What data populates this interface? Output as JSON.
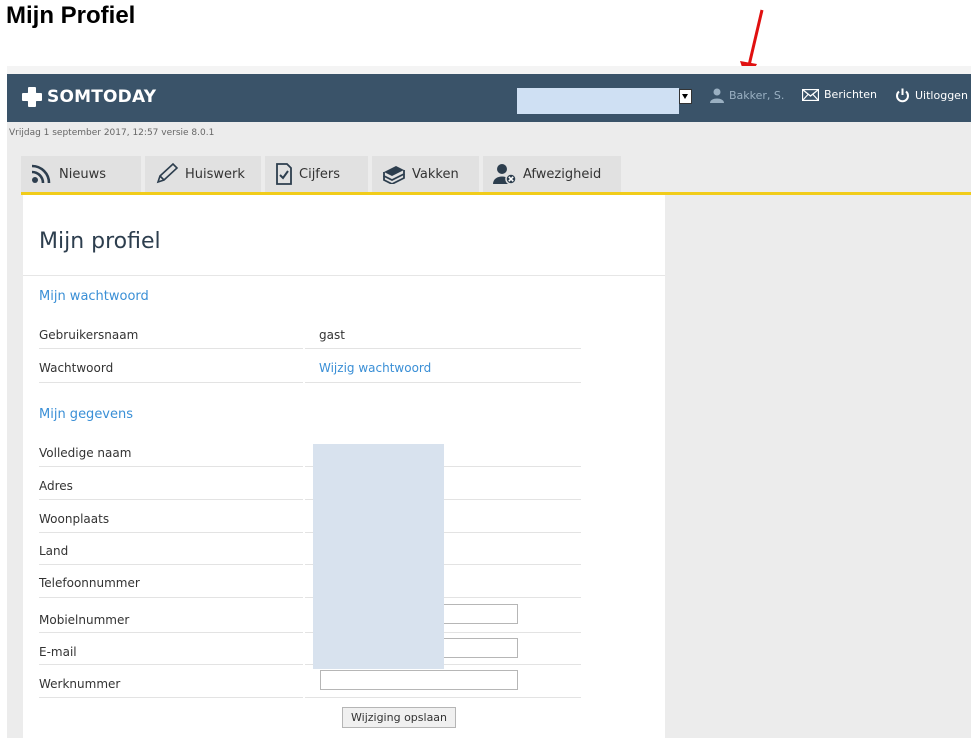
{
  "document": {
    "title": "Mijn Profiel"
  },
  "app": {
    "brand": "SOMTODAY",
    "accent_color": "#3a5369",
    "tab_underline_color": "#f1cc1a",
    "link_color": "#3a8fd6"
  },
  "topbar": {
    "search_value": "",
    "user_label": "Bakker, S.",
    "messages_label": "Berichten",
    "logout_label": "Uitloggen"
  },
  "status_line": "Vrijdag 1 september 2017, 12:57 versie 8.0.1",
  "tabs": [
    {
      "label": "Nieuws",
      "icon": "rss-icon"
    },
    {
      "label": "Huiswerk",
      "icon": "pencil-icon"
    },
    {
      "label": "Cijfers",
      "icon": "checked-document-icon"
    },
    {
      "label": "Vakken",
      "icon": "books-icon"
    },
    {
      "label": "Afwezigheid",
      "icon": "user-absent-icon"
    }
  ],
  "page": {
    "title": "Mijn profiel",
    "password_section": {
      "heading": "Mijn wachtwoord",
      "username_label": "Gebruikersnaam",
      "username_value": "gast",
      "password_label": "Wachtwoord",
      "password_link": "Wijzig wachtwoord"
    },
    "details_section": {
      "heading": "Mijn gegevens",
      "labels": {
        "full_name": "Volledige naam",
        "address": "Adres",
        "city": "Woonplaats",
        "country": "Land",
        "phone": "Telefoonnummer",
        "mobile": "Mobielnummer",
        "email": "E-mail",
        "work_number": "Werknummer"
      },
      "inputs": {
        "mobile": "",
        "email": "",
        "work_number": ""
      },
      "save_label": "Wijziging opslaan"
    }
  }
}
